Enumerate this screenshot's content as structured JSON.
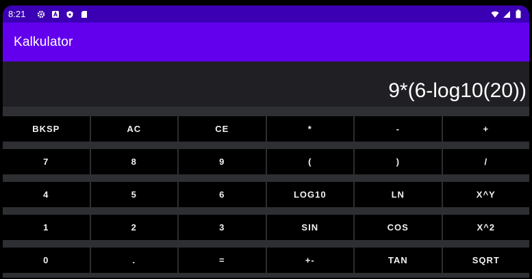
{
  "status_bar": {
    "time": "8:21",
    "icons": [
      "gear-icon",
      "a-icon",
      "shield-icon",
      "sd-card-icon"
    ],
    "right_icons": [
      "wifi-icon",
      "signal-icon",
      "battery-icon"
    ]
  },
  "app_bar": {
    "title": "Kalkulator"
  },
  "display": {
    "expression": "9*(6-log10(20))"
  },
  "keypad": {
    "rows": [
      [
        "BKSP",
        "AC",
        "CE",
        "*",
        "-",
        "+"
      ],
      [
        "7",
        "8",
        "9",
        "(",
        ")",
        "/"
      ],
      [
        "4",
        "5",
        "6",
        "LOG10",
        "LN",
        "X^Y"
      ],
      [
        "1",
        "2",
        "3",
        "SIN",
        "COS",
        "X^2"
      ],
      [
        "0",
        ".",
        "=",
        "+-",
        "TAN",
        "SQRT"
      ]
    ]
  },
  "colors": {
    "status_bar": "#3b00b4",
    "app_bar": "#6200ee",
    "display_bg": "#1f1f24",
    "key_bg": "#000000",
    "key_text": "#f2f2f2"
  }
}
